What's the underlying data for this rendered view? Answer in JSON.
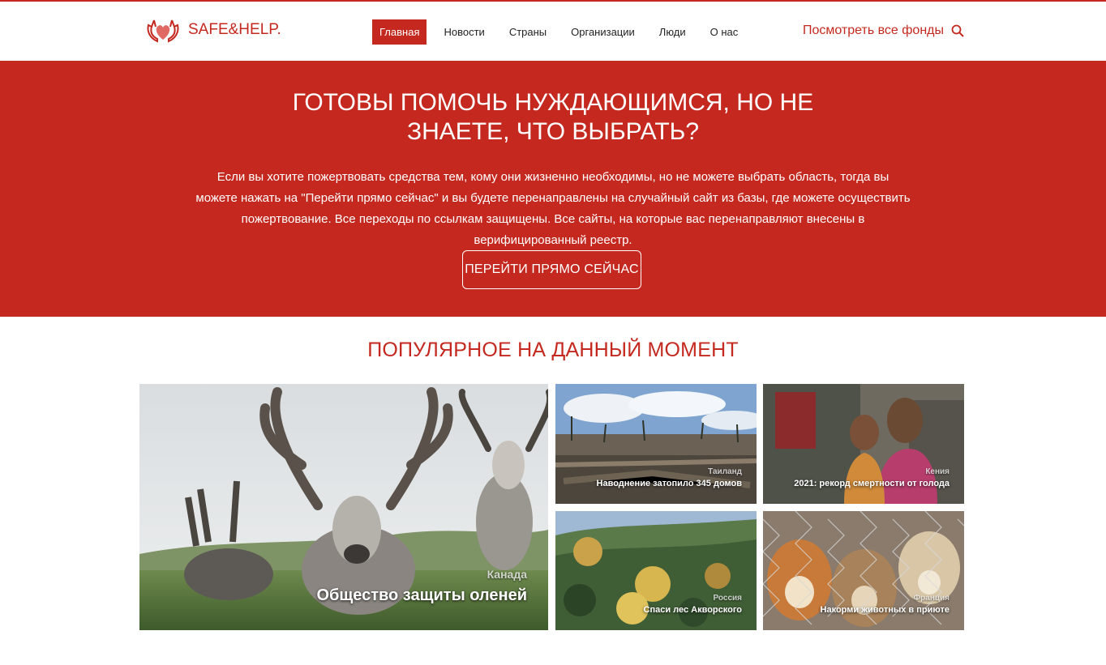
{
  "header": {
    "logo_text": "SAFE&HELP.",
    "nav": [
      "Главная",
      "Новости",
      "Страны",
      "Организации",
      "Люди",
      "О нас"
    ],
    "view_all": "Посмотреть все фонды"
  },
  "hero": {
    "title_line1": "ГОТОВЫ ПОМОЧЬ НУЖДАЮЩИМСЯ, НО НЕ",
    "title_line2": "ЗНАЕТЕ, ЧТО ВЫБРАТЬ?",
    "text": "Если вы хотите пожертвовать средства тем, кому они жизненно необходимы, но не можете выбрать область, тогда вы можете нажать на \"Перейти прямо сейчас\" и вы будете перенаправлены на случайный сайт из базы, где можете осуществить пожертвование. Все переходы по ссылкам защищены. Все сайты, на которые вас перенаправляют внесены в верифицированный реестр.",
    "button": "ПЕРЕЙТИ ПРЯМО СЕЙЧАС"
  },
  "popular": {
    "title": "ПОПУЛЯРНОЕ НА ДАННЫЙ МОМЕНТ",
    "items": [
      {
        "country": "Канада",
        "label": "Общество защиты оленей"
      },
      {
        "country": "Таиланд",
        "label": "Наводнение затопило 345 домов"
      },
      {
        "country": "Кения",
        "label": "2021: рекорд смертности от голода"
      },
      {
        "country": "Россия",
        "label": "Спаси лес Акворского"
      },
      {
        "country": "Франция",
        "label": "Накорми животных в приюте"
      }
    ]
  },
  "colors": {
    "brand": "#c4281f",
    "background": "#ffffff"
  }
}
